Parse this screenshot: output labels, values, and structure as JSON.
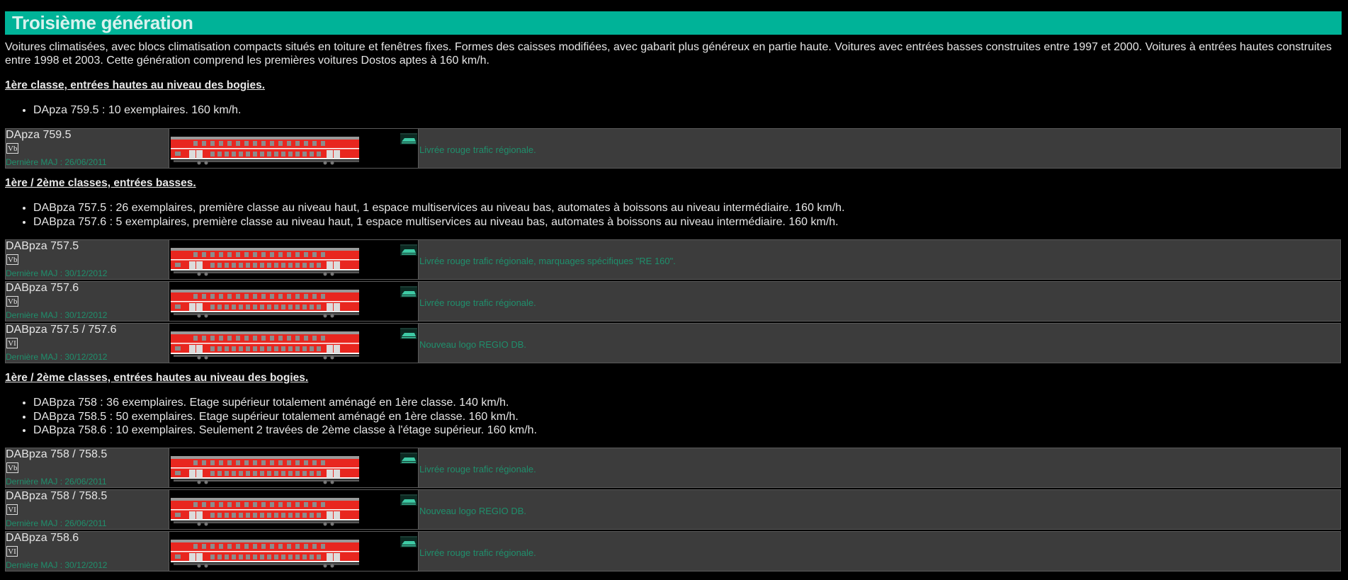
{
  "generation_title": "Troisième génération",
  "intro": "Voitures climatisées, avec blocs climatisation compacts situés en toiture et fenêtres fixes. Formes des caisses modifiées, avec gabarit plus généreux en partie haute. Voitures avec entrées basses construites entre 1997 et 2000. Voitures à entrées hautes construites entre 1998 et 2003. Cette génération comprend les premières voitures Dostos aptes à 160 km/h.",
  "sections": [
    {
      "title": "1ère classe, entrées hautes au niveau des bogies.",
      "bullets": [
        "DApza 759.5 : 10 exemplaires. 160 km/h."
      ],
      "rows": [
        {
          "model": "DApza 759.5",
          "era": "Vb",
          "maj": "Dernière MAJ : 26/06/2011",
          "desc": "Livrée rouge trafic régionale."
        }
      ]
    },
    {
      "title": "1ère / 2ème classes, entrées basses.",
      "bullets": [
        "DABpza 757.5 : 26 exemplaires, première classe au niveau haut, 1 espace multiservices au niveau bas, automates à boissons au niveau intermédiaire. 160 km/h.",
        "DABpza 757.6 : 5 exemplaires, première classe au niveau haut, 1 espace multiservices au niveau bas, automates à boissons au niveau intermédiaire. 160 km/h."
      ],
      "rows": [
        {
          "model": "DABpza 757.5",
          "era": "Vb",
          "maj": "Dernière MAJ : 30/12/2012",
          "desc": "Livrée rouge trafic régionale, marquages spécifiques \"RE 160\"."
        },
        {
          "model": "DABpza 757.6",
          "era": "Vb",
          "maj": "Dernière MAJ : 30/12/2012",
          "desc": "Livrée rouge trafic régionale."
        },
        {
          "model": "DABpza 757.5 / 757.6",
          "era": "VI",
          "maj": "Dernière MAJ : 30/12/2012",
          "desc": "Nouveau logo REGIO DB."
        }
      ]
    },
    {
      "title": "1ère / 2ème classes, entrées hautes au niveau des bogies.",
      "bullets": [
        "DABpza 758 : 36 exemplaires. Etage supérieur totalement aménagé en 1ère classe. 140 km/h.",
        "DABpza 758.5 : 50 exemplaires. Etage supérieur totalement aménagé en 1ère classe. 160 km/h.",
        "DABpza 758.6 : 10 exemplaires. Seulement 2 travées de 2ème classe à l'étage supérieur. 160 km/h."
      ],
      "rows": [
        {
          "model": "DABpza 758 / 758.5",
          "era": "Vb",
          "maj": "Dernière MAJ : 26/06/2011",
          "desc": "Livrée rouge trafic régionale."
        },
        {
          "model": "DABpza 758 / 758.5",
          "era": "VI",
          "maj": "Dernière MAJ : 26/06/2011",
          "desc": "Nouveau logo REGIO DB."
        },
        {
          "model": "DABpza 758.6",
          "era": "VI",
          "maj": "Dernière MAJ : 30/12/2012",
          "desc": "Livrée rouge trafic régionale."
        }
      ]
    }
  ],
  "colors": {
    "header_bg": "#00b398",
    "link_green": "#1f8f6c",
    "row_bg": "#3c3c3c",
    "coach_red": "#e8261f"
  },
  "icons": [
    "reverse-arrows-icon",
    "train-icon"
  ]
}
